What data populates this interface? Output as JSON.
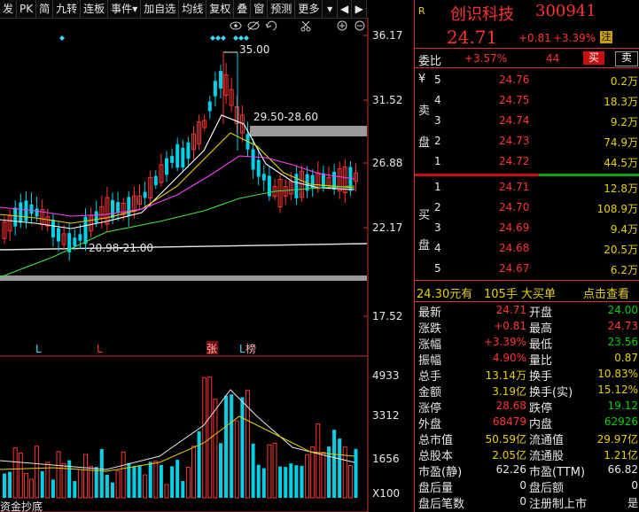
{
  "toolbar": {
    "items": [
      "发",
      "PK",
      "简",
      "九转",
      "连板",
      "事件",
      "加自选",
      "均线",
      "复权",
      "叠",
      "窗",
      "预测",
      "更多"
    ],
    "more_arrow": "▾",
    "event_arrow": "▾"
  },
  "chart": {
    "price_ticks": [
      "36.17",
      "31.52",
      "26.88",
      "22.17",
      "17.52"
    ],
    "vol_ticks": [
      "4933",
      "3312",
      "1656",
      "X100"
    ],
    "annotations": {
      "high": "35.00",
      "range": "29.50-28.60",
      "low_range": "20.98-21.00"
    },
    "markers": {
      "l1": "L",
      "l2": "L",
      "zhang": "张",
      "l3": "L",
      "bang": "榜"
    },
    "bottom_label": "资金抄底"
  },
  "quote": {
    "badge": "R",
    "name": "创识科技",
    "code": "300941",
    "price": "24.71",
    "change": "+0.81",
    "change_pct": "+3.39%",
    "tag": "注"
  },
  "weibi": {
    "label": "委比",
    "value": "+3.57%",
    "count": "44",
    "buy": "买",
    "sell": "卖"
  },
  "sell_side": {
    "labels": [
      "卖",
      "盘"
    ],
    "yen": "¥",
    "rows": [
      {
        "lvl": "5",
        "price": "24.76",
        "vol": "0.2万"
      },
      {
        "lvl": "4",
        "price": "24.75",
        "vol": "18.3万"
      },
      {
        "lvl": "3",
        "price": "24.74",
        "vol": "9.2万"
      },
      {
        "lvl": "2",
        "price": "24.73",
        "vol": "74.9万"
      },
      {
        "lvl": "1",
        "price": "24.72",
        "vol": "44.5万"
      }
    ]
  },
  "buy_side": {
    "labels": [
      "买",
      "盘"
    ],
    "rows": [
      {
        "lvl": "1",
        "price": "24.71",
        "vol": "12.8万"
      },
      {
        "lvl": "2",
        "price": "24.70",
        "vol": "108.9万"
      },
      {
        "lvl": "3",
        "price": "24.69",
        "vol": "9.4万"
      },
      {
        "lvl": "4",
        "price": "24.68",
        "vol": "20.5万"
      },
      {
        "lvl": "5",
        "price": "24.67",
        "vol": "6.2万"
      }
    ]
  },
  "big_order": {
    "price": "24.30元有",
    "qty": "105手",
    "label": "大买单",
    "link": "点击查看"
  },
  "stats": [
    {
      "k1": "最新",
      "v1": "24.71",
      "c1": "red",
      "k2": "开盘",
      "v2": "24.00",
      "c2": "green"
    },
    {
      "k1": "涨跌",
      "v1": "+0.81",
      "c1": "red",
      "k2": "最高",
      "v2": "24.73",
      "c2": "red"
    },
    {
      "k1": "涨幅",
      "v1": "+3.39%",
      "c1": "red",
      "k2": "最低",
      "v2": "23.56",
      "c2": "green"
    },
    {
      "k1": "振幅",
      "v1": "4.90%",
      "c1": "red",
      "k2": "量比",
      "v2": "0.87",
      "c2": "yellow"
    },
    {
      "k1": "总手",
      "v1": "13.14万",
      "c1": "yellow",
      "k2": "换手",
      "v2": "10.83%",
      "c2": "yellow"
    },
    {
      "k1": "金额",
      "v1": "3.19亿",
      "c1": "yellow",
      "k2": "换手(实)",
      "v2": "15.12%",
      "c2": "yellow"
    },
    {
      "k1": "涨停",
      "v1": "28.68",
      "c1": "red",
      "k2": "跌停",
      "v2": "19.12",
      "c2": "green"
    },
    {
      "k1": "外盘",
      "v1": "68479",
      "c1": "red",
      "k2": "内盘",
      "v2": "62926",
      "c2": "green"
    },
    {
      "k1": "总市值",
      "v1": "50.59亿",
      "c1": "yellow",
      "k2": "流通值",
      "v2": "29.97亿",
      "c2": "yellow"
    },
    {
      "k1": "总股本",
      "v1": "2.05亿",
      "c1": "yellow",
      "k2": "流通股",
      "v2": "1.21亿",
      "c2": "yellow"
    },
    {
      "k1": "市盈(静)",
      "v1": "62.26",
      "c1": "white",
      "k2": "市盈(TTM)",
      "v2": "66.82",
      "c2": "white"
    },
    {
      "k1": "盘后量",
      "v1": "0",
      "c1": "white",
      "k2": "盘后额",
      "v2": "0",
      "c2": "white"
    },
    {
      "k1": "盘后笔数",
      "v1": "0",
      "c1": "white",
      "k2": "注册制上市",
      "v2": "是",
      "c2": "white"
    }
  ],
  "colors": {
    "up": "#ff3232",
    "down": "#00d0e8",
    "ma5": "#ffffff",
    "ma10": "#e8d000",
    "ma20": "#ff40ff",
    "ma60": "#40e040"
  }
}
